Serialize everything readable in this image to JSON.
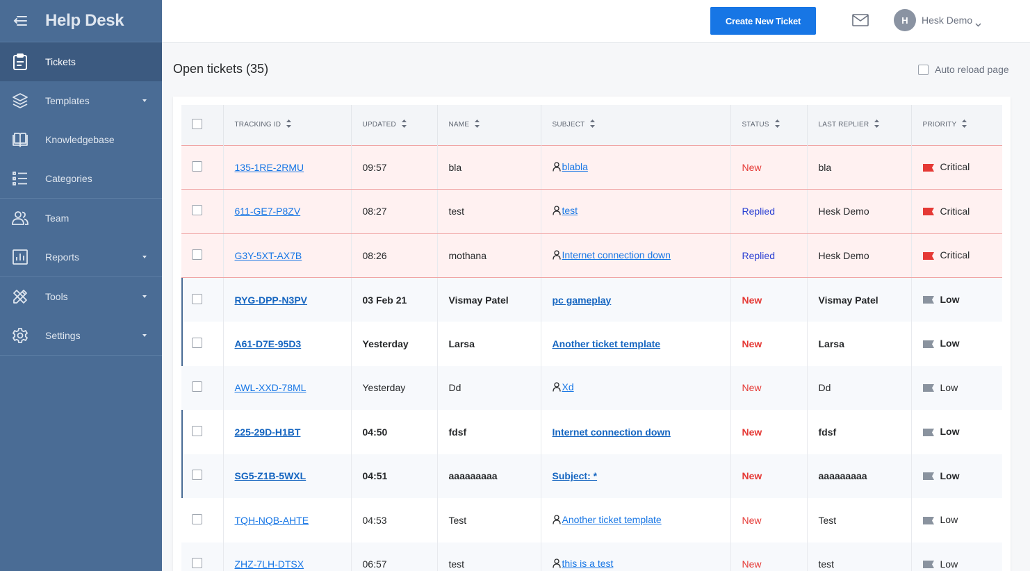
{
  "app": {
    "title": "Help Desk"
  },
  "sidebar": {
    "items": [
      {
        "label": "Tickets",
        "icon": "clipboard-icon",
        "active": true
      },
      {
        "label": "Templates",
        "icon": "layers-icon",
        "has_submenu": true
      },
      {
        "label": "Knowledgebase",
        "icon": "book-icon"
      },
      {
        "label": "Categories",
        "icon": "list-icon"
      },
      {
        "label": "Team",
        "icon": "users-icon"
      },
      {
        "label": "Reports",
        "icon": "bar-chart-icon",
        "has_submenu": true
      },
      {
        "label": "Tools",
        "icon": "tools-icon",
        "has_submenu": true
      },
      {
        "label": "Settings",
        "icon": "gear-icon",
        "has_submenu": true
      }
    ]
  },
  "topbar": {
    "create_label": "Create New Ticket",
    "user_initial": "H",
    "user_name": "Hesk Demo"
  },
  "page": {
    "title": "Open tickets (35)",
    "auto_reload_label": "Auto reload page"
  },
  "table": {
    "columns": [
      "TRACKING ID",
      "UPDATED",
      "NAME",
      "SUBJECT",
      "STATUS",
      "LAST REPLIER",
      "PRIORITY"
    ],
    "rows": [
      {
        "id": "135-1RE-2RMU",
        "updated": "09:57",
        "name": "bla",
        "subject": "blabla",
        "customer_icon": true,
        "status": "New",
        "last_replier": "bla",
        "priority": "Critical",
        "style": "critical"
      },
      {
        "id": "611-GE7-P8ZV",
        "updated": "08:27",
        "name": "test",
        "subject": "test",
        "customer_icon": true,
        "status": "Replied",
        "last_replier": "Hesk Demo",
        "priority": "Critical",
        "style": "critical"
      },
      {
        "id": "G3Y-5XT-AX7B",
        "updated": "08:26",
        "name": "mothana",
        "subject": "Internet connection down",
        "customer_icon": true,
        "status": "Replied",
        "last_replier": "Hesk Demo",
        "priority": "Critical",
        "style": "critical"
      },
      {
        "id": "RYG-DPP-N3PV",
        "updated": "03 Feb 21",
        "name": "Vismay Patel",
        "subject": "pc gameplay",
        "customer_icon": false,
        "status": "New",
        "last_replier": "Vismay Patel",
        "priority": "Low",
        "style": "unread-alt"
      },
      {
        "id": "A61-D7E-95D3",
        "updated": "Yesterday",
        "name": "Larsa",
        "subject": "Another ticket template",
        "customer_icon": false,
        "status": "New",
        "last_replier": "Larsa",
        "priority": "Low",
        "style": "unread"
      },
      {
        "id": "AWL-XXD-78ML",
        "updated": "Yesterday",
        "name": "Dd",
        "subject": "Xd",
        "customer_icon": true,
        "status": "New",
        "last_replier": "Dd",
        "priority": "Low",
        "style": "alt"
      },
      {
        "id": "225-29D-H1BT",
        "updated": "04:50",
        "name": "fdsf",
        "subject": "Internet connection down",
        "customer_icon": false,
        "status": "New",
        "last_replier": "fdsf",
        "priority": "Low",
        "style": "unread"
      },
      {
        "id": "SG5-Z1B-5WXL",
        "updated": "04:51",
        "name": "aaaaaaaaa",
        "subject": "Subject: *",
        "customer_icon": false,
        "status": "New",
        "last_replier": "aaaaaaaaa",
        "priority": "Low",
        "style": "unread-alt"
      },
      {
        "id": "TQH-NQB-AHTE",
        "updated": "04:53",
        "name": "Test",
        "subject": "Another ticket template",
        "customer_icon": true,
        "status": "New",
        "last_replier": "Test",
        "priority": "Low",
        "style": "plain"
      },
      {
        "id": "ZHZ-7LH-DTSX",
        "updated": "06:57",
        "name": "test",
        "subject": "this is a test",
        "customer_icon": true,
        "status": "New",
        "last_replier": "test",
        "priority": "Low",
        "style": "alt"
      }
    ]
  },
  "colors": {
    "sidebar_bg": "#4a6c95",
    "primary_button": "#1776e5",
    "critical_flag": "#e53935",
    "low_flag": "#8a939f",
    "status_new": "#e53935",
    "status_replied": "#2a3fd3"
  }
}
